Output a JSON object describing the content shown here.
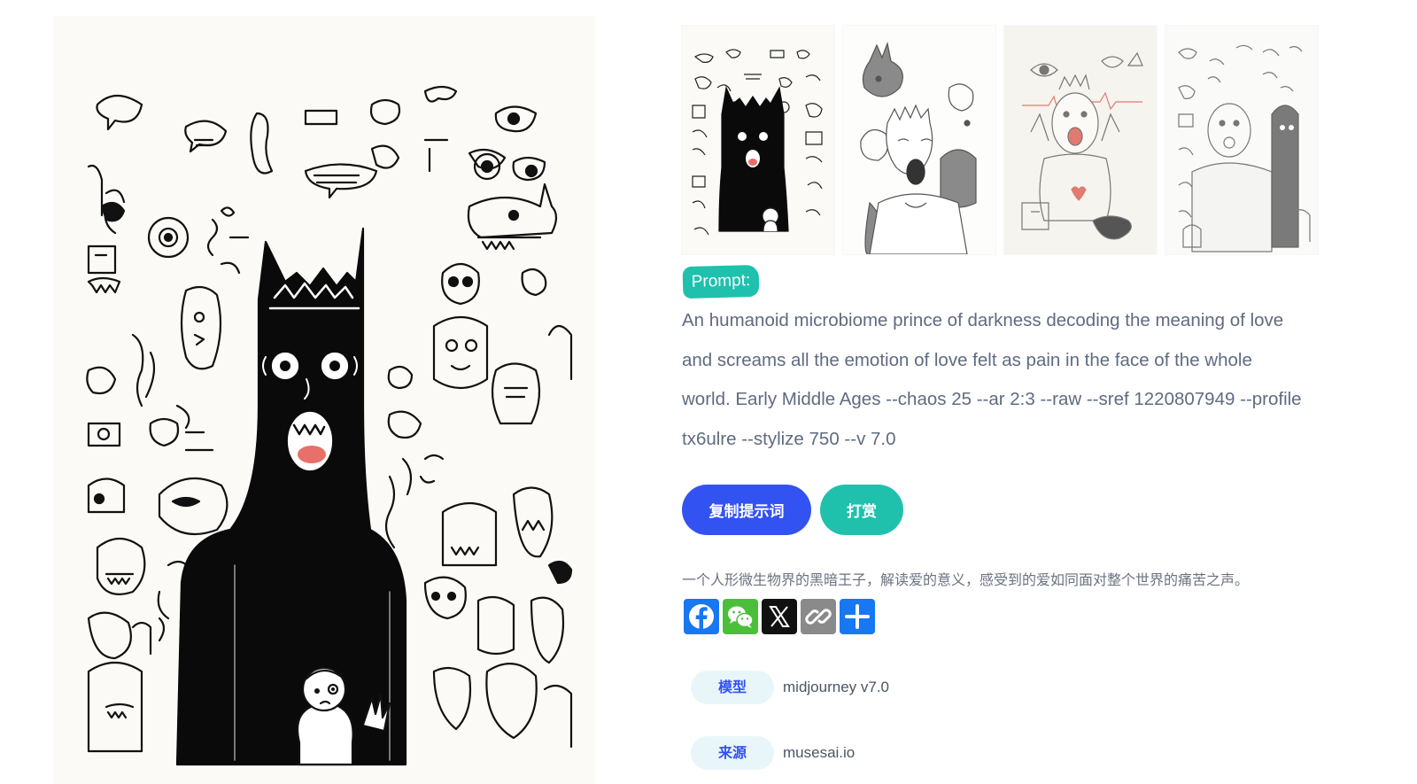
{
  "prompt": {
    "label": "Prompt:",
    "text": "An humanoid microbiome prince of darkness decoding the meaning of love and screams all the emotion of love felt as pain in the face of the whole world. Early Middle Ages --chaos 25 --ar 2:3 --raw --sref 1220807949 --profile tx6ulre --stylize 750 --v 7.0"
  },
  "actions": {
    "copy_label": "复制提示词",
    "tip_label": "打赏"
  },
  "description_cn": "一个人形微生物界的黑暗王子，解读爱的意义，感受到的爱如同面对整个世界的痛苦之声。",
  "share": [
    {
      "name": "facebook",
      "icon": "facebook-icon",
      "color": "#1877f2"
    },
    {
      "name": "wechat",
      "icon": "wechat-icon",
      "color": "#4bbf3a"
    },
    {
      "name": "x",
      "icon": "x-icon",
      "color": "#111111"
    },
    {
      "name": "copy-link",
      "icon": "link-icon",
      "color": "#8a8a8a"
    },
    {
      "name": "share",
      "icon": "plus-icon",
      "color": "#1877f2"
    }
  ],
  "meta": {
    "model_label": "模型",
    "model_value": "midjourney v7.0",
    "source_label": "来源",
    "source_value": "musesai.io"
  },
  "colors": {
    "accent_blue": "#3352f2",
    "accent_teal": "#1fc1ad",
    "text_gray": "#5f6b80"
  }
}
